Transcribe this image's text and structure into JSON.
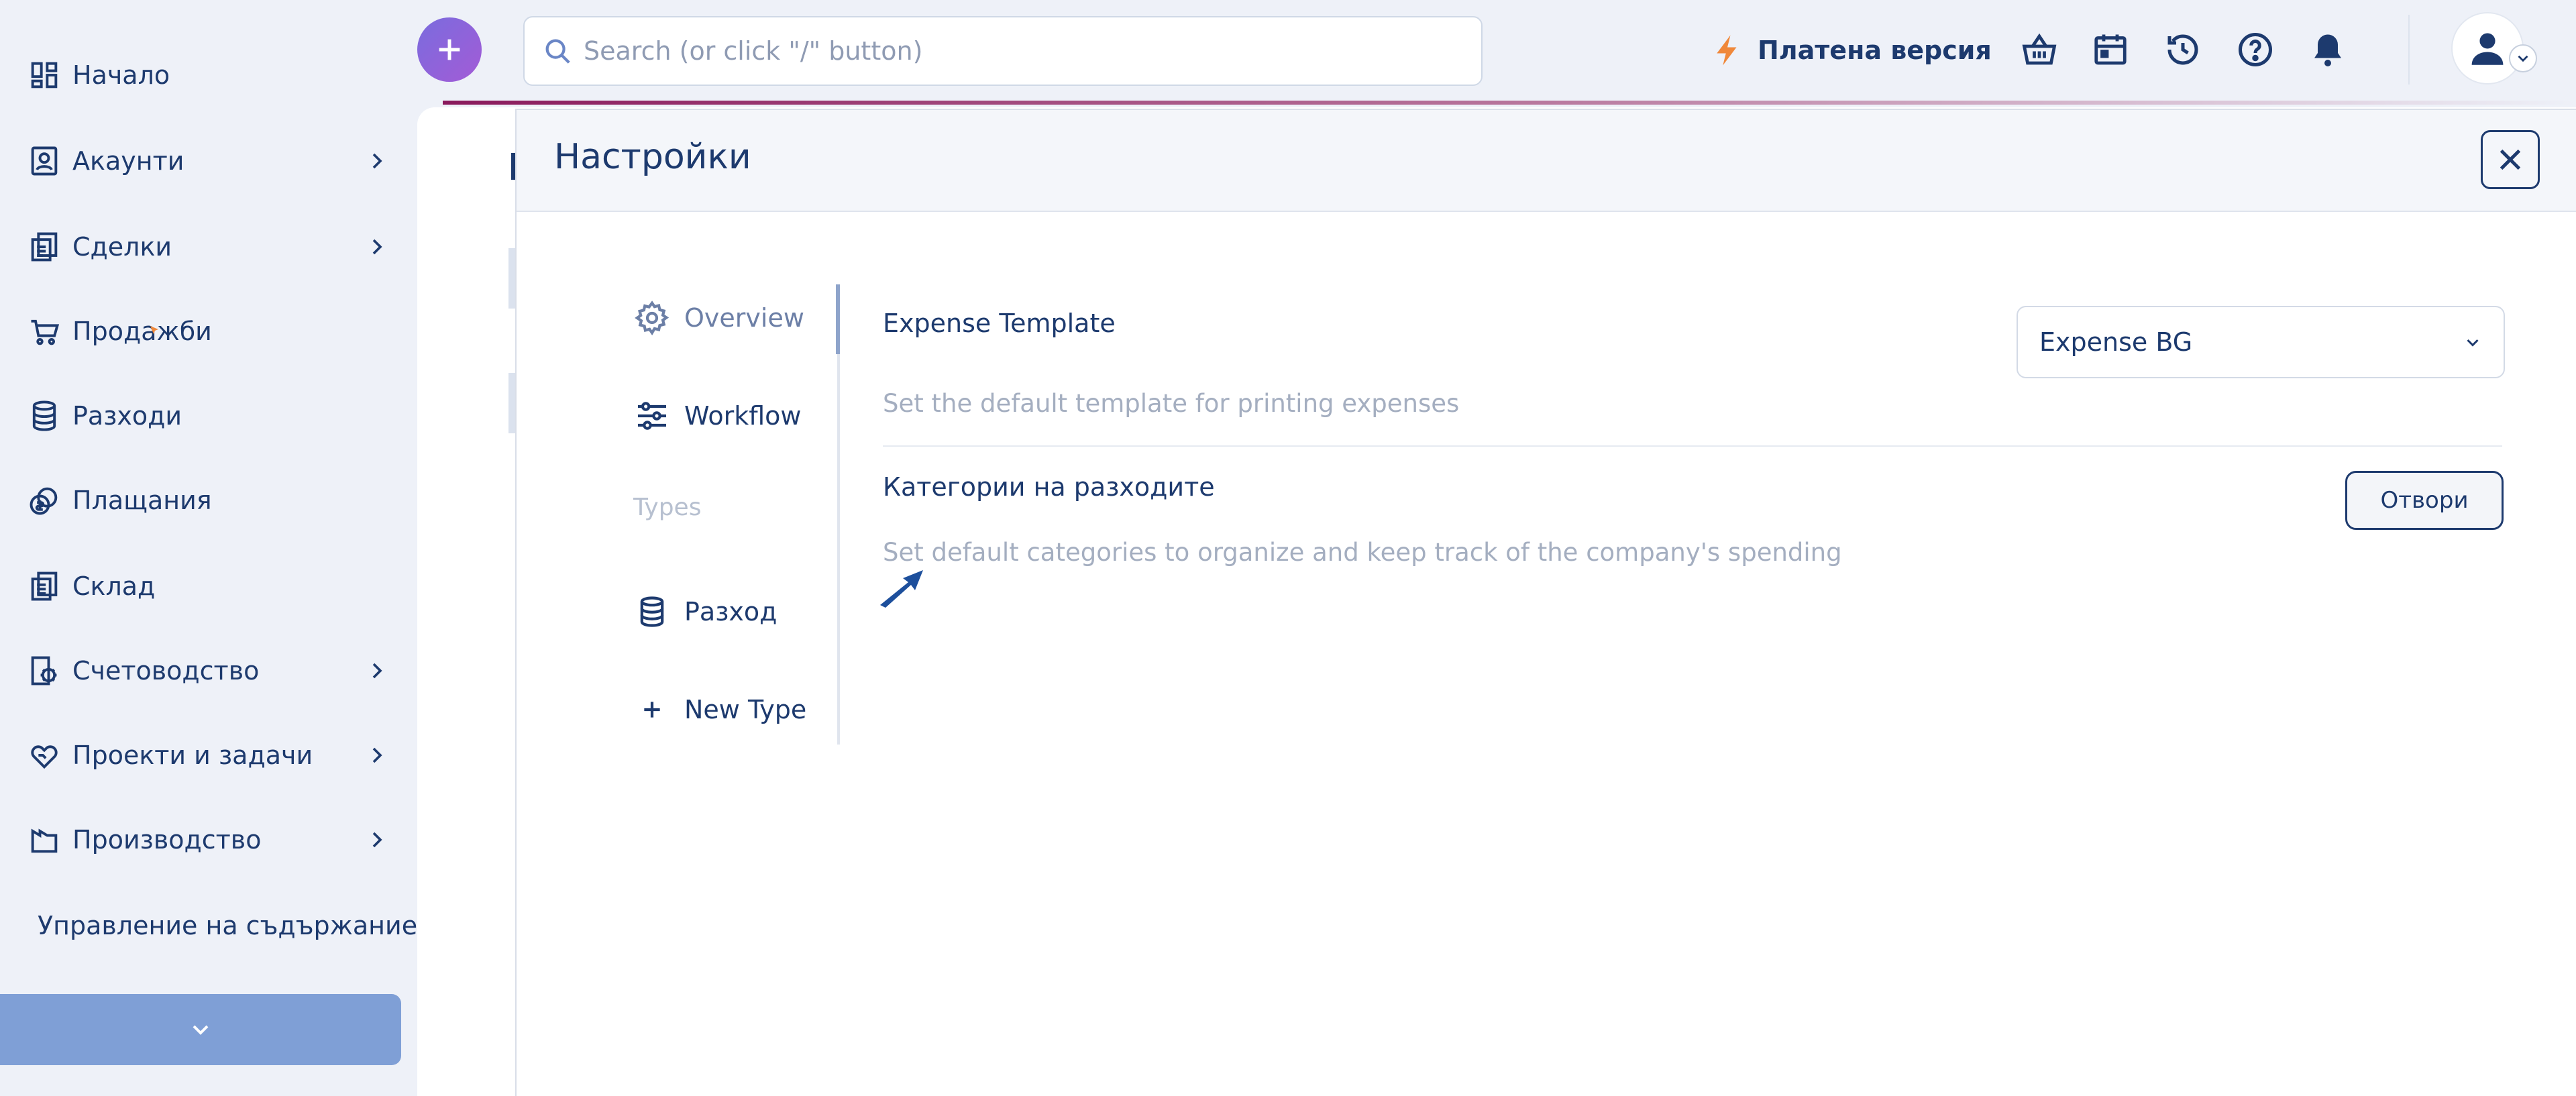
{
  "sidebar": {
    "items": [
      {
        "label": "Начало",
        "icon": "dashboard-icon",
        "has_children": false
      },
      {
        "label": "Акаунти",
        "icon": "contact-card-icon",
        "has_children": true
      },
      {
        "label": "Сделки",
        "icon": "documents-icon",
        "has_children": true
      },
      {
        "label": "Продажби",
        "icon": "cart-icon",
        "has_children": false
      },
      {
        "label": "Разходи",
        "icon": "database-icon",
        "has_children": false
      },
      {
        "label": "Плащания",
        "icon": "coins-icon",
        "has_children": false
      },
      {
        "label": "Склад",
        "icon": "clipboard-icon",
        "has_children": false
      },
      {
        "label": "Счетоводство",
        "icon": "accounting-gear-icon",
        "has_children": true
      },
      {
        "label": "Проекти и задачи",
        "icon": "heart-hands-icon",
        "has_children": true
      },
      {
        "label": "Производство",
        "icon": "factory-icon",
        "has_children": true
      },
      {
        "label": "Управление на съдържание",
        "icon": "newspaper-icon",
        "has_children": false
      }
    ]
  },
  "topbar": {
    "search_placeholder": "Search (or click \"/\" button)",
    "plan_label": "Платена версия",
    "icons": [
      "basket-icon",
      "calendar-icon",
      "history-icon",
      "help-icon",
      "bell-icon"
    ]
  },
  "modal": {
    "title": "Настройки",
    "tabs": [
      {
        "label": "Overview",
        "icon": "gear-icon",
        "active": true
      },
      {
        "label": "Workflow",
        "icon": "sliders-icon",
        "active": false
      }
    ],
    "types_heading": "Types",
    "type_items": [
      {
        "label": "Разход",
        "icon": "database-icon"
      },
      {
        "label": "New Type",
        "icon": "plus-icon"
      }
    ],
    "settings": [
      {
        "title": "Expense Template",
        "description": "Set the default template for printing expenses",
        "control": "select",
        "value": "Expense BG"
      },
      {
        "title": "Категории на разходите",
        "description": "Set default categories to organize and keep track of the company's spending",
        "control": "button",
        "button_label": "Отвори"
      }
    ]
  },
  "colors": {
    "primary": "#1d3a6e",
    "accent_gradient_start": "#7a6cde",
    "accent_gradient_end": "#a35bd6",
    "bolt": "#f0883a",
    "muted_text": "#a4aec0",
    "sidebar_collapse": "#7f9fd6"
  }
}
